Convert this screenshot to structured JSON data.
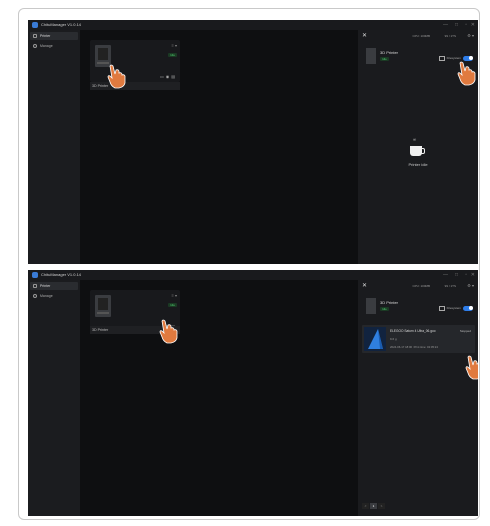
{
  "app": {
    "title": "ChituManager V1.0.14",
    "controls": {
      "minimize": "—",
      "maximize": "□",
      "restore": "▫",
      "close": "✕"
    }
  },
  "sidebar": {
    "items": [
      {
        "label": "Printer",
        "icon": "printer-icon"
      },
      {
        "label": "Manage",
        "icon": "gear-icon"
      }
    ]
  },
  "main": {
    "printer_card": {
      "name": "3D Printer",
      "status": "Idle",
      "menu": "≡ ▾"
    }
  },
  "panel": {
    "close": "✕",
    "cpu": "CPU: 100MB",
    "mem": "99 / 1TS",
    "menu": "⚙ ▾",
    "printer_name": "3D Printer",
    "status_badge": "Idle",
    "filesystem_label": "Filesystem",
    "idle_text": "Printer idle",
    "steam": "ꟹ"
  },
  "file": {
    "name": "ELEGOO Saturn 4 Ultra_06.goo",
    "size": "9.6 g",
    "date": "2024-06-17 18:00",
    "print_time": "Print time: 02:05:24",
    "action": "Stopped"
  },
  "pager": {
    "prev": "<",
    "current": "1",
    "next": ">"
  },
  "colors": {
    "accent": "#2e7de9",
    "status_green": "#4cc36a",
    "background": "#111214"
  }
}
